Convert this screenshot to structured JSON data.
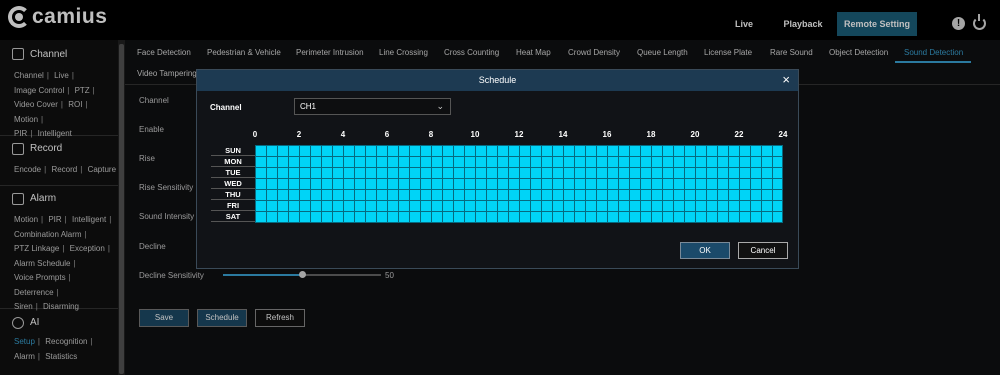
{
  "brand": {
    "name": "camius"
  },
  "topnav": [
    {
      "label": "Live",
      "active": false
    },
    {
      "label": "Playback",
      "active": false
    },
    {
      "label": "Remote Setting",
      "active": true
    }
  ],
  "header_icons": {
    "info": "info-icon",
    "power": "power-icon",
    "info_glyph": "!"
  },
  "sidebar": {
    "sections": [
      {
        "title": "Channel",
        "icon": "channel-icon",
        "links": [
          "Channel",
          "Live",
          "Image Control",
          "PTZ",
          "Video Cover",
          "ROI",
          "Motion",
          "PIR",
          "Intelligent"
        ]
      },
      {
        "title": "Record",
        "icon": "record-icon",
        "links": [
          "Encode",
          "Record",
          "Capture"
        ]
      },
      {
        "title": "Alarm",
        "icon": "alarm-icon",
        "links": [
          "Motion",
          "PIR",
          "Intelligent",
          "Combination Alarm",
          "PTZ Linkage",
          "Exception",
          "Alarm Schedule",
          "Voice Prompts",
          "Deterrence",
          "Siren",
          "Disarming"
        ]
      },
      {
        "title": "AI",
        "icon": "ai-icon",
        "links": [
          "Setup",
          "Recognition",
          "Alarm",
          "Statistics"
        ],
        "active_link": "Setup"
      }
    ]
  },
  "tabs": [
    {
      "label": "Face Detection"
    },
    {
      "label": "Pedestrian & Vehicle"
    },
    {
      "label": "Perimeter Intrusion"
    },
    {
      "label": "Line Crossing"
    },
    {
      "label": "Cross Counting"
    },
    {
      "label": "Heat Map"
    },
    {
      "label": "Crowd Density"
    },
    {
      "label": "Queue Length"
    },
    {
      "label": "License Plate"
    },
    {
      "label": "Rare Sound"
    },
    {
      "label": "Object Detection"
    },
    {
      "label": "Sound Detection",
      "active": true
    },
    {
      "label": "Video Tampering"
    }
  ],
  "form": {
    "labels": [
      "Channel",
      "Enable",
      "Rise",
      "Rise Sensitivity",
      "Sound Intensity",
      "Decline",
      "Decline Sensitivity"
    ],
    "decline_sensitivity": {
      "value": "50",
      "fraction": 0.5
    },
    "buttons": {
      "save": "Save",
      "schedule": "Schedule",
      "refresh": "Refresh"
    }
  },
  "modal": {
    "title": "Schedule",
    "close": "×",
    "channel_label": "Channel",
    "channel_value": "CH1",
    "chevron": "⌄",
    "hours": [
      "0",
      "2",
      "4",
      "6",
      "8",
      "10",
      "12",
      "14",
      "16",
      "18",
      "20",
      "22",
      "24"
    ],
    "days": [
      "SUN",
      "MON",
      "TUE",
      "WED",
      "THU",
      "FRI",
      "SAT"
    ],
    "schedule_color": "#00d4f7",
    "all_hours_selected": true,
    "ok": "OK",
    "cancel": "Cancel"
  },
  "colors": {
    "accent": "#3aa3d4",
    "active_nav": "#1b5f7a",
    "modal_header": "#1d3a52"
  }
}
